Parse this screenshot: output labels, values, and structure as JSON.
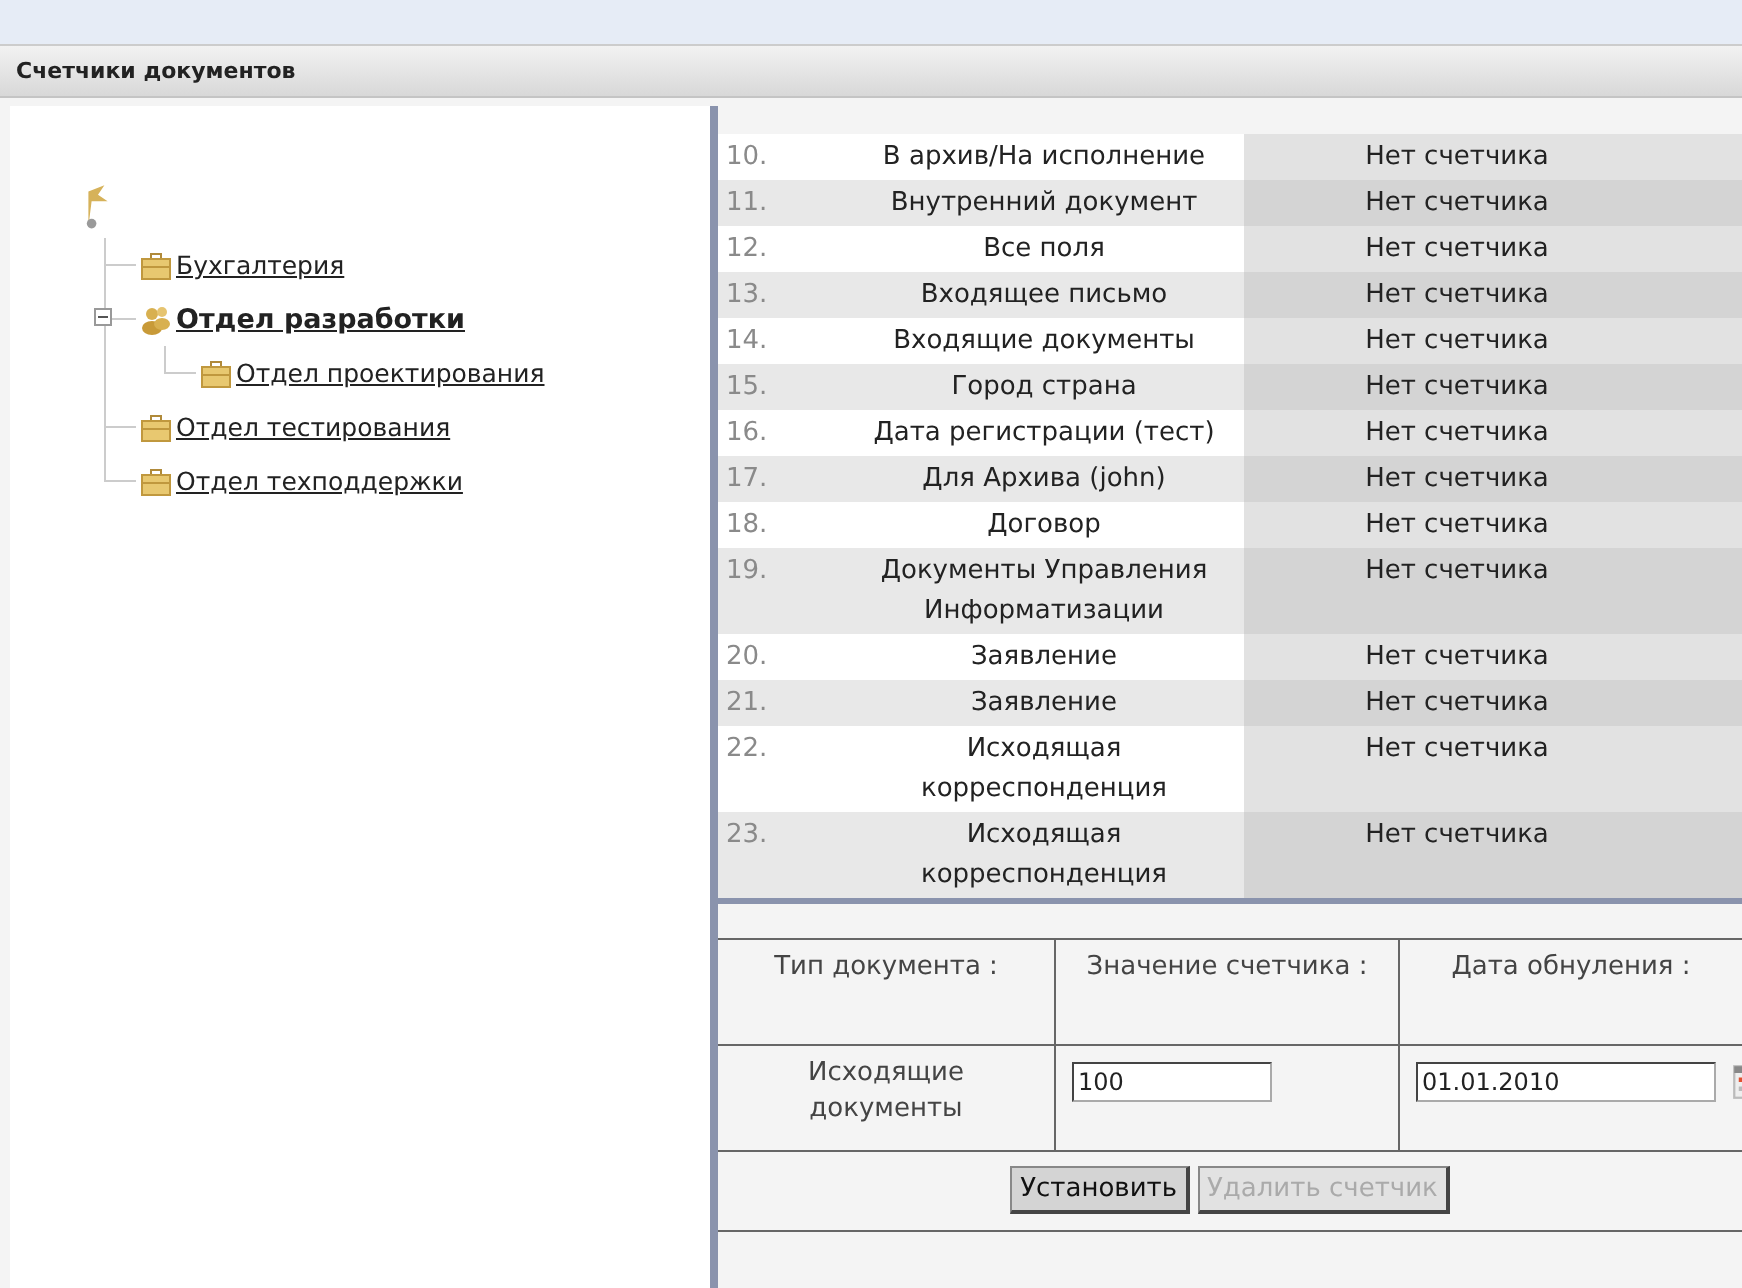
{
  "panel": {
    "title": "Счетчики документов"
  },
  "tree": {
    "children": [
      {
        "label": "Бухгалтерия",
        "selected": false
      },
      {
        "label": "Отдел разработки",
        "selected": true,
        "expanded": true,
        "children": [
          {
            "label": "Отдел проектирования",
            "selected": false
          }
        ]
      },
      {
        "label": "Отдел тестирования",
        "selected": false
      },
      {
        "label": "Отдел техподдержки",
        "selected": false
      }
    ]
  },
  "table": {
    "rows": [
      {
        "number": "10.",
        "name": "В архив/На исполнение",
        "counter": "Нет счетчика"
      },
      {
        "number": "11.",
        "name": "Внутренний документ",
        "counter": "Нет счетчика"
      },
      {
        "number": "12.",
        "name": "Все поля",
        "counter": "Нет счетчика"
      },
      {
        "number": "13.",
        "name": "Входящее письмо",
        "counter": "Нет счетчика"
      },
      {
        "number": "14.",
        "name": "Входящие документы",
        "counter": "Нет счетчика"
      },
      {
        "number": "15.",
        "name": "Город страна",
        "counter": "Нет счетчика"
      },
      {
        "number": "16.",
        "name": "Дата регистрации (тест)",
        "counter": "Нет счетчика"
      },
      {
        "number": "17.",
        "name": "Для Архива (john)",
        "counter": "Нет счетчика"
      },
      {
        "number": "18.",
        "name": "Договор",
        "counter": "Нет счетчика"
      },
      {
        "number": "19.",
        "name": "Документы Управления Информатизации",
        "counter": "Нет счетчика"
      },
      {
        "number": "20.",
        "name": "Заявление",
        "counter": "Нет счетчика"
      },
      {
        "number": "21.",
        "name": "Заявление",
        "counter": "Нет счетчика"
      },
      {
        "number": "22.",
        "name": "Исходящая корреспонденция",
        "counter": "Нет счетчика"
      },
      {
        "number": "23.",
        "name": "Исходящая корреспонденция",
        "counter": "Нет счетчика"
      }
    ]
  },
  "form": {
    "columns": [
      "Тип документа :",
      "Значение счетчика :",
      "Дата обнуления :"
    ],
    "document_type": "Исходящие документы",
    "counter_value": "100",
    "reset_date": "01.01.2010",
    "buttons": [
      {
        "label": "Установить",
        "disabled": false
      },
      {
        "label": "Удалить счетчик",
        "disabled": true
      }
    ]
  }
}
